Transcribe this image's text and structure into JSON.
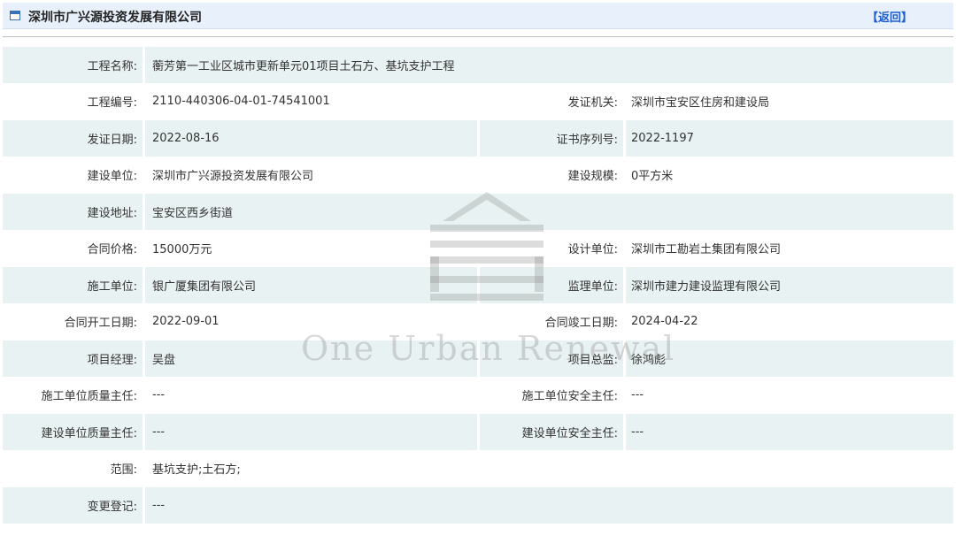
{
  "header": {
    "title": "深圳市广兴源投资发展有限公司",
    "back_label": "【返回】"
  },
  "rows": [
    {
      "l1": "工程名称:",
      "v1": "蘅芳第一工业区城市更新单元01项目土石方、基坑支护工程",
      "wide": true
    },
    {
      "l1": "工程编号:",
      "v1": "2110-440306-04-01-74541001",
      "l2": "发证机关:",
      "v2": "深圳市宝安区住房和建设局"
    },
    {
      "l1": "发证日期:",
      "v1": "2022-08-16",
      "l2": "证书序列号:",
      "v2": "2022-1197"
    },
    {
      "l1": "建设单位:",
      "v1": "深圳市广兴源投资发展有限公司",
      "l2": "建设规模:",
      "v2": "0平方米"
    },
    {
      "l1": "建设地址:",
      "v1": "宝安区西乡街道",
      "wide": true
    },
    {
      "l1": "合同价格:",
      "v1": "15000万元",
      "l2": "设计单位:",
      "v2": "深圳市工勘岩土集团有限公司"
    },
    {
      "l1": "施工单位:",
      "v1": "银广厦集团有限公司",
      "l2": "监理单位:",
      "v2": "深圳市建力建设监理有限公司"
    },
    {
      "l1": "合同开工日期:",
      "v1": "2022-09-01",
      "l2": "合同竣工日期:",
      "v2": "2024-04-22"
    },
    {
      "l1": "项目经理:",
      "v1": "吴盘",
      "l2": "项目总监:",
      "v2": "徐鸿彪"
    },
    {
      "l1": "施工单位质量主任:",
      "v1": "---",
      "l2": "施工单位安全主任:",
      "v2": "---"
    },
    {
      "l1": "建设单位质量主任:",
      "v1": "---",
      "l2": "建设单位安全主任:",
      "v2": "---"
    },
    {
      "l1": "范围:",
      "v1": "基坑支护;土石方;",
      "wide": true
    },
    {
      "l1": "变更登记:",
      "v1": "---",
      "wide": true
    }
  ],
  "watermark": {
    "text": "One Urban Renewal",
    "icon": "building-logo-icon"
  }
}
